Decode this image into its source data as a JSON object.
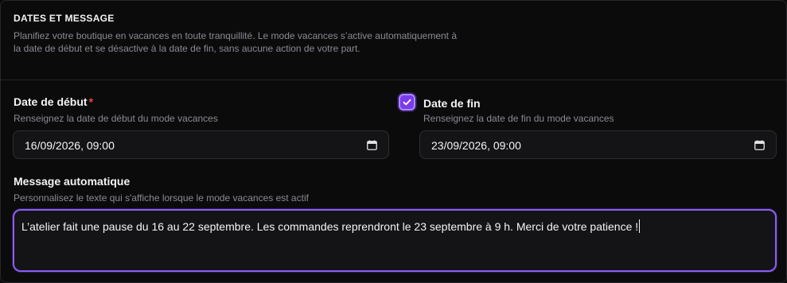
{
  "section": {
    "title": "DATES ET MESSAGE",
    "description": "Planifiez votre boutique en vacances en toute tranquillité. Le mode vacances s’active automatiquement à la date de début et se désactive à la date de fin, sans aucune action de votre part."
  },
  "start_date": {
    "label": "Date de début",
    "required_mark": "*",
    "hint": "Renseignez la date de début du mode vacances",
    "value": "16/09/2026, 09:00"
  },
  "end_date": {
    "enabled": true,
    "label": "Date de fin",
    "hint": "Renseignez la date de fin du mode vacances",
    "value": "23/09/2026, 09:00"
  },
  "message": {
    "label": "Message automatique",
    "hint": "Personnalisez le texte qui s'affiche lorsque le mode vacances est actif",
    "value": "L’atelier fait une pause du 16 au 22 septembre. Les commandes reprendront le 23 septembre à 9 h. Merci de votre patience !"
  },
  "icons": {
    "calendar": "calendar-icon",
    "check": "checkmark-icon"
  },
  "colors": {
    "accent": "#7c3aed",
    "focus_border": "#8b5cf6",
    "required": "#ef4444",
    "background": "#0b0b0c",
    "muted_text": "#8a8a93"
  }
}
